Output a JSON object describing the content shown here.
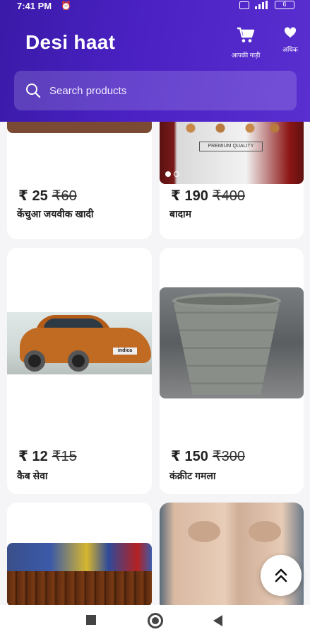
{
  "status_bar": {
    "time": "7:41 PM",
    "battery": "6"
  },
  "header": {
    "title": "Desi haat",
    "cart_label": "आपकी गाड़ी",
    "more_label": "अधिक"
  },
  "search": {
    "placeholder": "Search products"
  },
  "products": [
    {
      "price": "₹ 25",
      "old_price": "₹60",
      "name": "केंचुआ जयवीक खादी"
    },
    {
      "price": "₹ 190",
      "old_price": "₹400",
      "name": "बादाम",
      "image_text": "PREMIUM QUALITY"
    },
    {
      "price": "₹ 12",
      "old_price": "₹15",
      "name": "कैब सेवा",
      "image_text": "indica"
    },
    {
      "price": "₹ 150",
      "old_price": "₹300",
      "name": "कंक्रीट गमला"
    }
  ],
  "colors": {
    "header": "#4b21c4",
    "card": "#ffffff",
    "background": "#f5f5f7"
  }
}
